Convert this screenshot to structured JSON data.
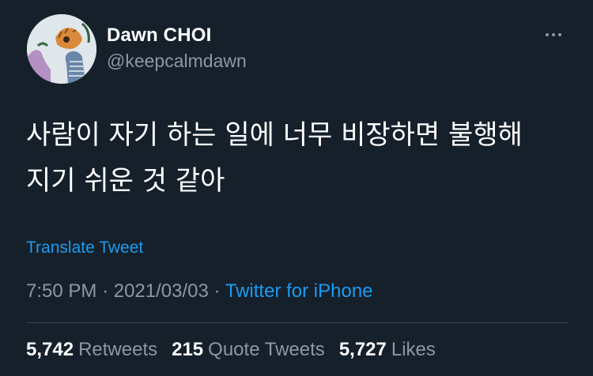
{
  "author": {
    "name": "Dawn CHOI",
    "handle": "@keepcalmdawn"
  },
  "tweet": {
    "text": "사람이 자기 하는 일에 너무 비장하면 불행해\n지기 쉬운 것 같아",
    "translate_label": "Translate Tweet",
    "time": "7:50 PM",
    "date": "2021/03/03",
    "separator": "·",
    "source": "Twitter for iPhone"
  },
  "stats": {
    "retweets_count": "5,742",
    "retweets_label": "Retweets",
    "quotes_count": "215",
    "quotes_label": "Quote Tweets",
    "likes_count": "5,727",
    "likes_label": "Likes"
  },
  "icons": {
    "more": "more-horizontal-icon"
  },
  "colors": {
    "background": "#15202b",
    "text_primary": "#ffffff",
    "text_secondary": "#8b98a5",
    "link": "#1d9bf0",
    "divider": "#38444d"
  }
}
